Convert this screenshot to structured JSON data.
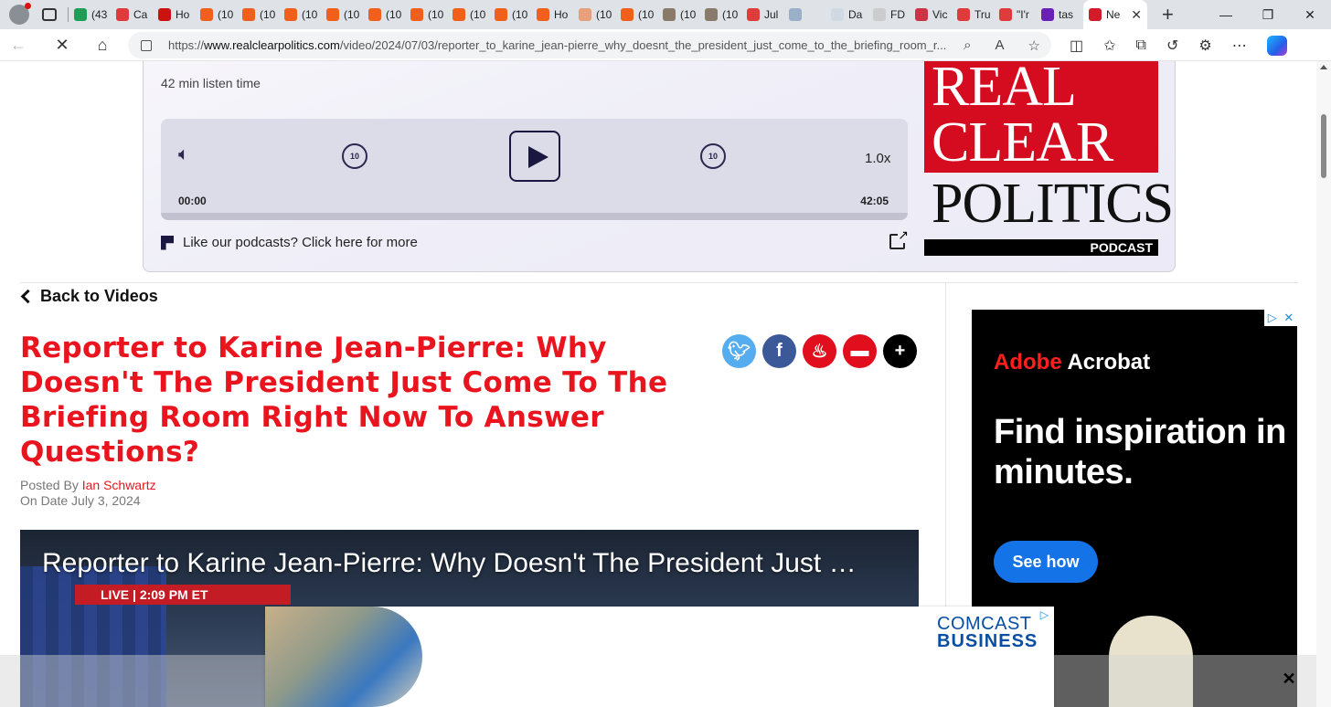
{
  "browser": {
    "tabs": [
      {
        "label": "(43",
        "color": "#1f9d55"
      },
      {
        "label": "Ca",
        "color": "#e03b3b"
      },
      {
        "label": "Ho",
        "color": "#cc1111"
      },
      {
        "label": "(10",
        "color": "#f0601a"
      },
      {
        "label": "(10",
        "color": "#f0601a"
      },
      {
        "label": "(10",
        "color": "#f0601a"
      },
      {
        "label": "(10",
        "color": "#f0601a"
      },
      {
        "label": "(10",
        "color": "#f0601a"
      },
      {
        "label": "(10",
        "color": "#f0601a"
      },
      {
        "label": "(10",
        "color": "#f0601a"
      },
      {
        "label": "(10",
        "color": "#f0601a"
      },
      {
        "label": "Ho",
        "color": "#f0601a"
      },
      {
        "label": "(10",
        "color": "#e8a07a"
      },
      {
        "label": "(10",
        "color": "#f0601a"
      },
      {
        "label": "(10",
        "color": "#8a7a6a"
      },
      {
        "label": "(10",
        "color": "#8a7a6a"
      },
      {
        "label": "Jul",
        "color": "#e03b3b"
      },
      {
        "label": "",
        "color": "#9ab0c8"
      },
      {
        "label": "Da",
        "color": "#cfd8e3"
      },
      {
        "label": "FD",
        "color": "#cccccc"
      },
      {
        "label": "Vic",
        "color": "#cc3344"
      },
      {
        "label": "Tru",
        "color": "#e03b3b"
      },
      {
        "label": "\"I'r",
        "color": "#e03b3b"
      },
      {
        "label": "tas",
        "color": "#6a1fb5"
      }
    ],
    "active_tab": {
      "label": "Ne",
      "color": "#d41b2a"
    },
    "url_scheme": "https://",
    "url_host": "www.realclearpolitics.com",
    "url_path": "/video/2024/07/03/reporter_to_karine_jean-pierre_why_doesnt_the_president_just_come_to_the_briefing_room_r..."
  },
  "podcast": {
    "listen_time": "42 min listen time",
    "speed": "1.0x",
    "time_current": "00:00",
    "time_total": "42:05",
    "skip_seconds": "10",
    "more_link": "Like our podcasts? Click here for more",
    "logo_line1": "REAL",
    "logo_line2": "CLEAR",
    "logo_line3": "POLITICS",
    "logo_tag": "PODCAST",
    "progress": 0
  },
  "article": {
    "back_link": "Back to Videos",
    "title": "Reporter to Karine Jean-Pierre: Why Doesn't The President Just Come To The Briefing Room Right Now To Answer Questions?",
    "posted_by_label": "Posted By",
    "author": "Ian Schwartz",
    "date_label": "On Date",
    "date": "July 3, 2024",
    "share_icons": [
      "twitter-icon",
      "facebook-icon",
      "gettr-icon",
      "comment-icon",
      "plus-icon"
    ]
  },
  "video": {
    "overlay_title": "Reporter to Karine Jean-Pierre: Why Doesn't The President Just …",
    "live_badge": "LIVE  |  2:09 PM ET"
  },
  "ad_right": {
    "brand_a": "Adobe",
    "brand_b": " Acrobat",
    "headline": "Find inspiration in minutes.",
    "cta": "See how"
  },
  "ad_bottom": {
    "brand_line1": "COMCAST",
    "brand_line2": "BUSINESS",
    "close": "✕"
  }
}
